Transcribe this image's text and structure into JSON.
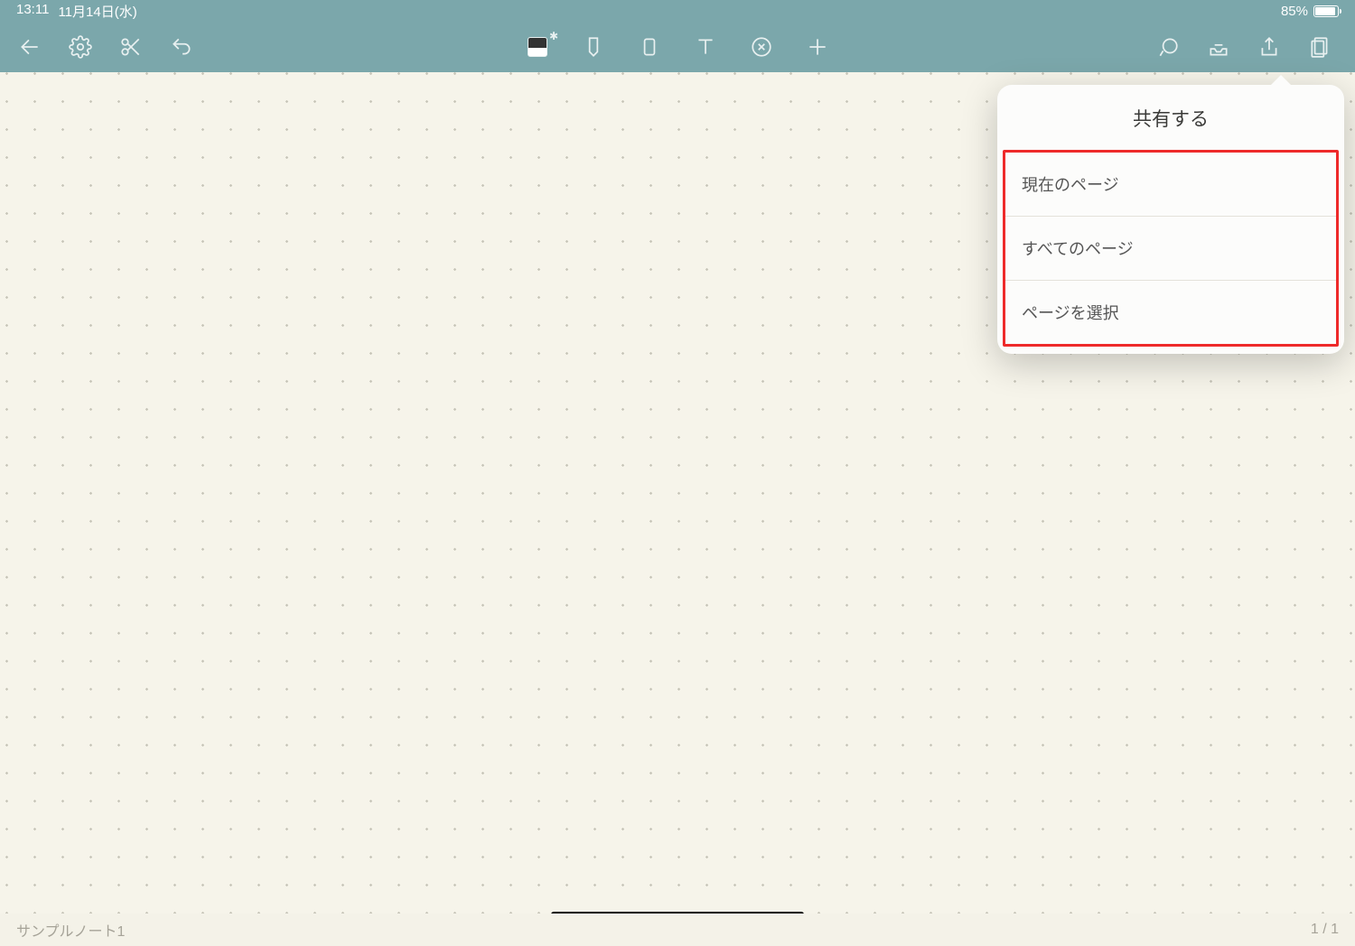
{
  "status": {
    "time": "13:11",
    "date": "11月14日(水)",
    "battery_pct": "85%"
  },
  "popover": {
    "title": "共有する",
    "items": [
      {
        "label": "現在のページ"
      },
      {
        "label": "すべてのページ"
      },
      {
        "label": "ページを選択"
      }
    ]
  },
  "bottom": {
    "note_title": "サンプルノート1",
    "page_indicator": "1 / 1"
  },
  "icons": {
    "back": "back-icon",
    "settings": "gear-icon",
    "scissors": "scissors-icon",
    "undo": "undo-icon",
    "stylus": "stylus-device-icon",
    "pen": "pen-icon",
    "eraser": "eraser-icon",
    "text": "text-tool-icon",
    "shape": "close-circle-icon",
    "add": "plus-icon",
    "loop": "lasso-icon",
    "tray": "tray-icon",
    "share": "share-icon",
    "pages": "pages-icon"
  }
}
